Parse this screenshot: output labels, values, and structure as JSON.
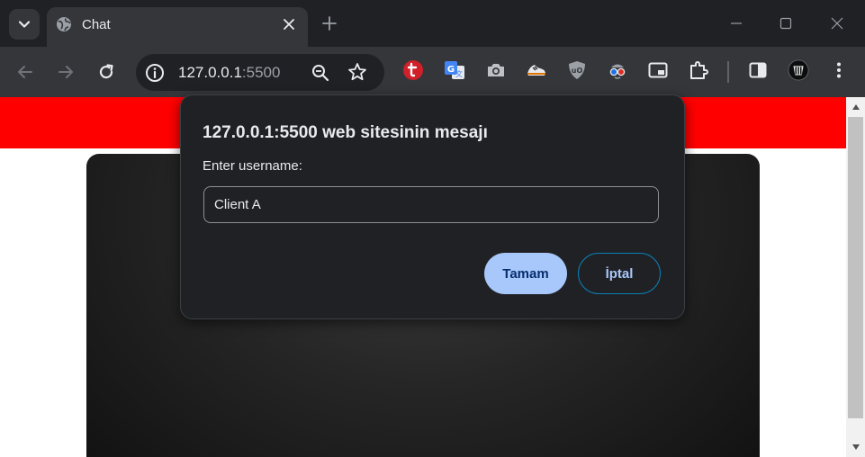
{
  "browser": {
    "tab": {
      "title": "Chat"
    },
    "address_bar": {
      "host": "127.0.0.1",
      "port": ":5500"
    }
  },
  "dialog": {
    "title": "127.0.0.1:5500 web sitesinin mesajı",
    "message": "Enter username:",
    "input_value": "Client A",
    "ok_label": "Tamam",
    "cancel_label": "İptal"
  },
  "page": {
    "header_color": "#ff0000"
  },
  "extensions": [
    "tubi-extension-icon",
    "google-translate-icon",
    "camera-icon",
    "sneaker-icon",
    "ublock-icon",
    "spy-glasses-icon",
    "picture-in-picture-icon",
    "extensions-puzzle-icon"
  ]
}
